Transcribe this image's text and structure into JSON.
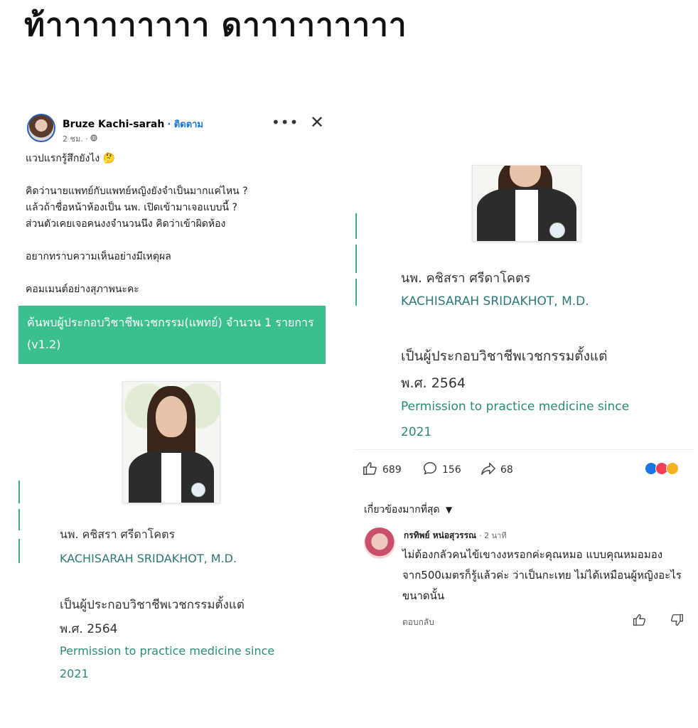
{
  "headline": "ท้าาาาาาาาา ดาาาาาาาาา",
  "post": {
    "author": "Bruze Kachi-sarah",
    "follow_label": "· ติดตาม",
    "time": "2 ชม. ·",
    "lines": [
      "แวปแรกรู้สึกยังไง 🤔",
      "",
      "คิดว่านายแพทย์กับแพทย์หญิงยังจำเป็นมากแค่ไหน ?",
      "แล้วถ้าชื่อหน้าห้องเป็น นพ. เปิดเข้ามาเจอแบบนี้ ?",
      "ส่วนตัวเคยเจอคนงงจำนวนนึง คิดว่าเข้าผิดห้อง",
      "",
      "อยากทราบความเห็นอย่างมีเหตุผล",
      "",
      "คอมเมนต์อย่างสุภาพนะคะ"
    ],
    "banner": "ค้นพบผู้ประกอบวิชาชีพเวชกรรม(แพทย์) จำนวน 1 รายการ (v1.2)",
    "doctor": {
      "name_th": "นพ. คชิสรา ศรีดาโคตร",
      "name_en": "KACHISARAH SRIDAKHOT, M.D.",
      "since_th_line1": "เป็นผู้ประกอบวิชาชีพเวชกรรมตั้งแต่",
      "since_th_line2": "พ.ศ. 2564",
      "since_en_line1": "Permission to practice medicine since",
      "since_en_line2": "2021"
    }
  },
  "stats": {
    "likes": "689",
    "comments": "156",
    "shares": "68"
  },
  "sort_label": "เกี่ยวข้องมากที่สุด",
  "comment": {
    "author": "กรทิพย์ หน่อสุวรรณ",
    "time": "· 2 นาที",
    "text": "ไม่ต้องกลัวคนไข้เขางงหรอกค่ะคุณหมอ แบบคุณหมอมองจาก500เมตรก็รู้แล้วค่ะ ว่าเป็นกะเทย ไม่ได้เหมือนผู้หญิงอะไรขนาดนั้น",
    "reply_label": "ตอบกลับ"
  },
  "colors": {
    "banner_green": "#3bbf8f",
    "link_teal": "#2b8a78",
    "facebook_blue": "#1b74e4"
  }
}
